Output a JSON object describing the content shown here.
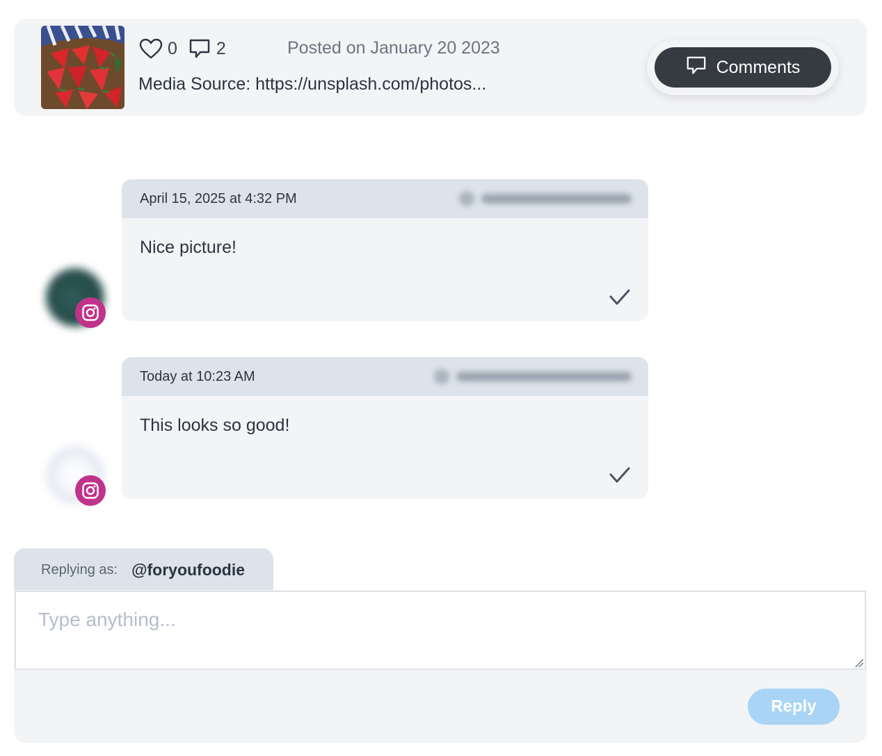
{
  "post": {
    "likes_count": "0",
    "comments_count": "2",
    "posted": "Posted on January 20 2023",
    "media_source": "Media Source: https://unsplash.com/photos...",
    "comments_button_label": "Comments",
    "icons": {
      "like": "heart-icon",
      "comments": "speech-bubble-icon",
      "thumbnail": "watermelon-photo"
    }
  },
  "comments": [
    {
      "date": "April 15, 2025 at 4:32 PM",
      "text": "Nice picture!",
      "platform": "instagram",
      "status_icon": "checkmark-icon"
    },
    {
      "date": "Today at 10:23 AM",
      "text": "This looks so good!",
      "platform": "instagram",
      "status_icon": "checkmark-icon"
    }
  ],
  "reply": {
    "replying_as_label": "Replying as:",
    "handle": "@foryoufoodie",
    "placeholder": "Type anything...",
    "button_label": "Reply"
  },
  "colors": {
    "card_bg": "#f3f4f6",
    "header_bg": "#dde3ea",
    "comments_button_bg": "#363b42",
    "instagram": "#c0338a",
    "reply_button_bg": "#a9d4f5"
  }
}
